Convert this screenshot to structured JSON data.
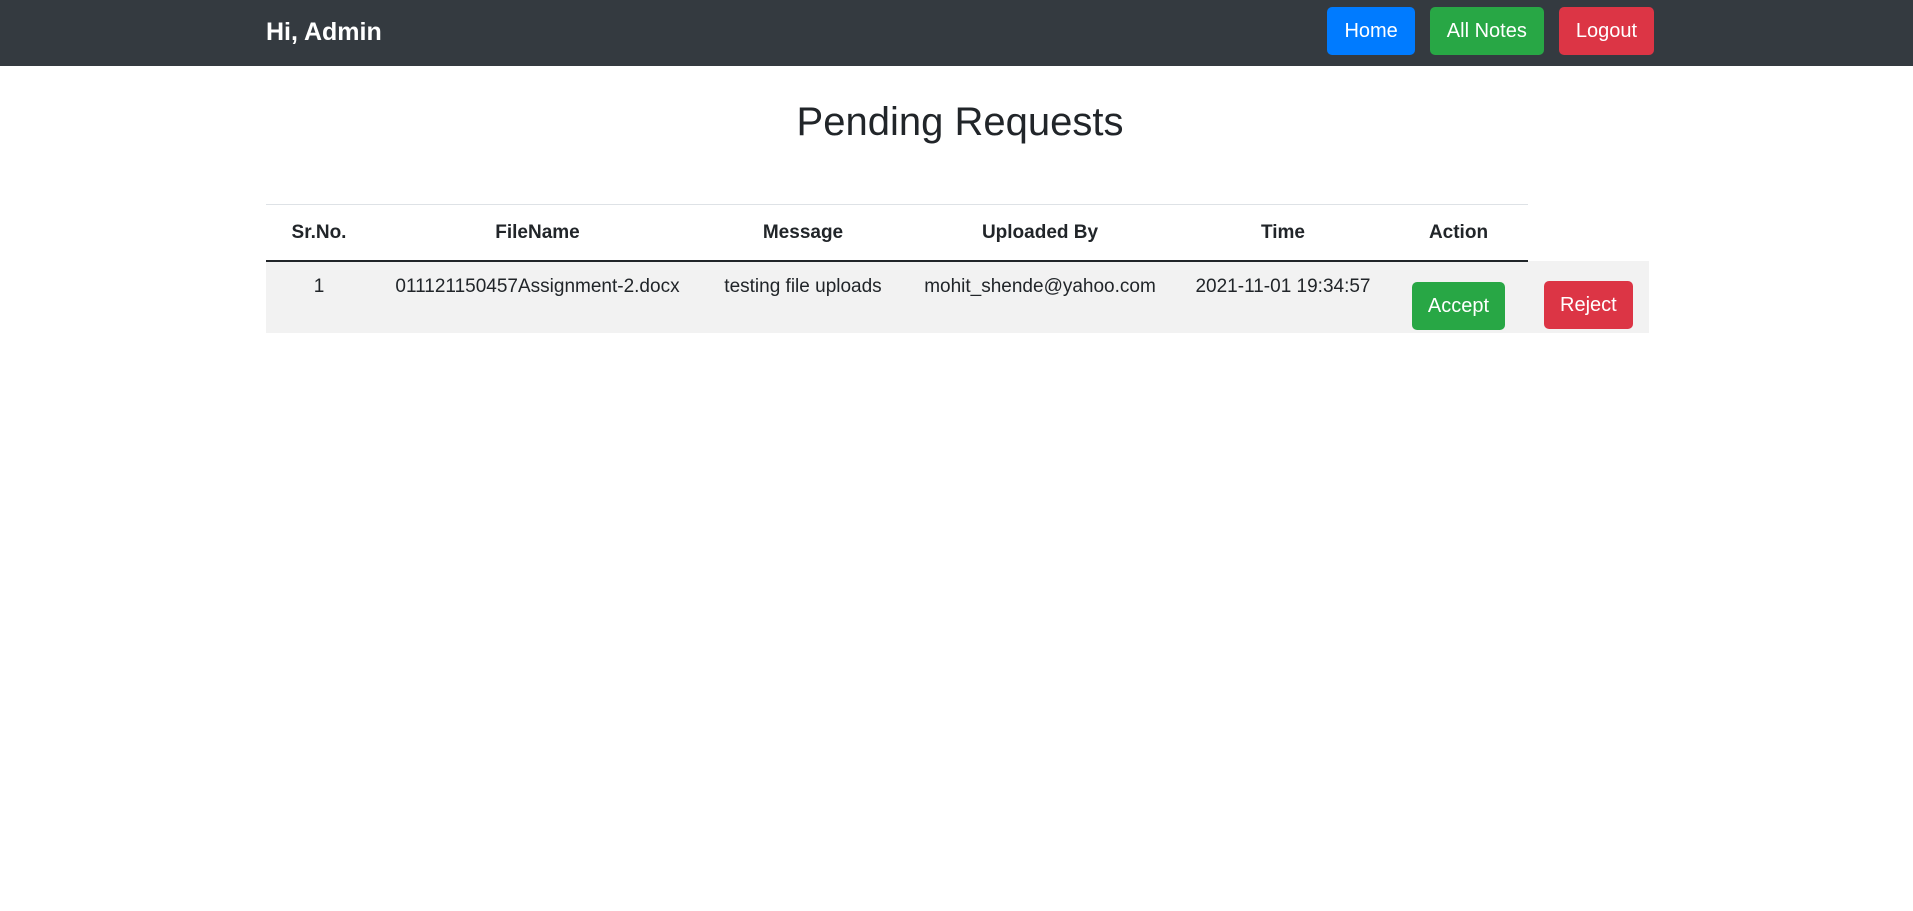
{
  "navbar": {
    "greeting": "Hi, Admin",
    "buttons": {
      "home": "Home",
      "all_notes": "All Notes",
      "logout": "Logout"
    }
  },
  "page": {
    "title": "Pending Requests"
  },
  "table": {
    "headers": [
      "Sr.No.",
      "FileName",
      "Message",
      "Uploaded By",
      "Time",
      "Action"
    ],
    "rows": [
      {
        "sr_no": "1",
        "filename": "011121150457Assignment-2.docx",
        "message": "testing file uploads",
        "uploaded_by": "mohit_shende@yahoo.com",
        "time": "2021-11-01 19:34:57",
        "accept_label": "Accept",
        "reject_label": "Reject"
      }
    ]
  },
  "colors": {
    "navbar_bg": "#343a40",
    "primary": "#007bff",
    "success": "#28a745",
    "danger": "#dc3545",
    "row_bg": "#f2f2f2"
  }
}
